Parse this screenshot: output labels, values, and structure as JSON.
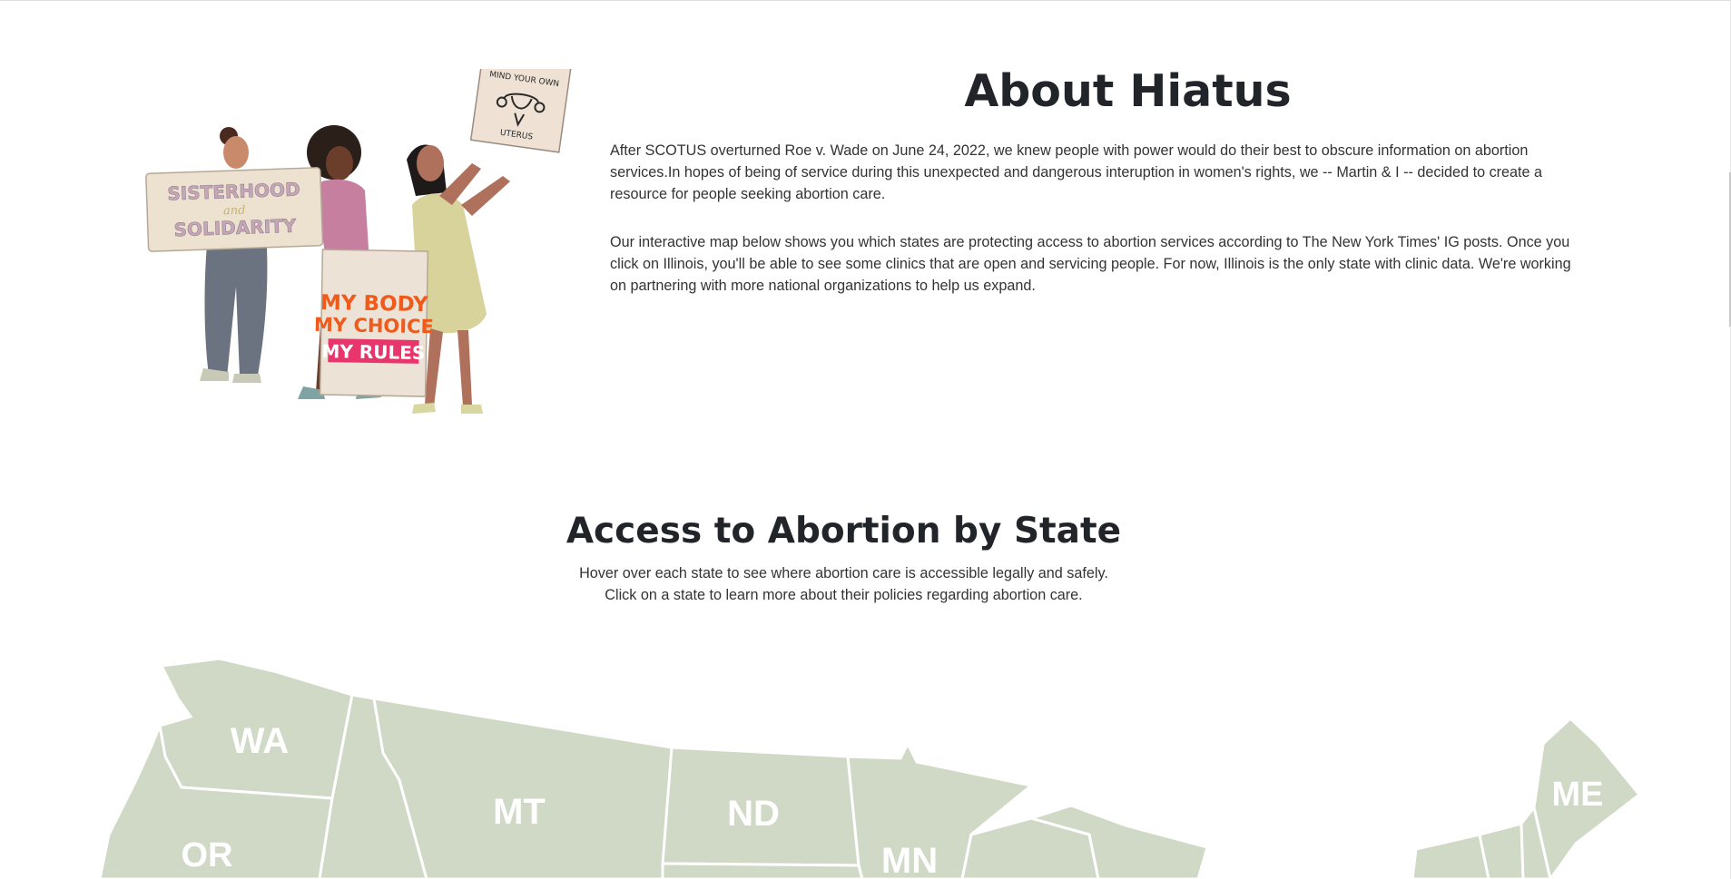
{
  "about": {
    "title": "About Hiatus",
    "paragraph_1": "After SCOTUS overturned Roe v. Wade on June 24, 2022, we knew people with power would do their best to obscure information on abortion services.In hopes of being of service during this unexpected and dangerous interuption in women's rights, we -- Martin & I -- decided to create a resource for people seeking abortion care.",
    "paragraph_2": "Our interactive map below shows you which states are protecting access to abortion services according to The New York Times' IG posts. Once you click on Illinois, you'll be able to see some clinics that are open and servicing people. For now, Illinois is the only state with clinic data. We're working on partnering with more national organizations to help us expand."
  },
  "illustration": {
    "sign_1_line_1": "SISTERHOOD",
    "sign_1_line_2": "and",
    "sign_1_line_3": "SOLIDARITY",
    "sign_2_line_1": "MY BODY",
    "sign_2_line_2": "MY CHOICE",
    "sign_2_line_3": "MY RULES",
    "sign_3_line_1": "MIND YOUR OWN",
    "sign_3_line_2": "UTERUS"
  },
  "access": {
    "title": "Access to Abortion by State",
    "subtitle_1": "Hover over each state to see where abortion care is accessible legally and safely.",
    "subtitle_2": "Click on a state to learn more about their policies regarding abortion care."
  },
  "map": {
    "fill_color": "#cfd9c6",
    "border_color": "#ffffff",
    "states": {
      "wa": "WA",
      "or": "OR",
      "mt": "MT",
      "nd": "ND",
      "mn": "MN",
      "me": "ME"
    }
  }
}
